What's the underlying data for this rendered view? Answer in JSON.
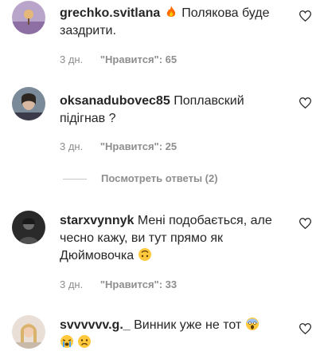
{
  "comments": [
    {
      "username": "grechko.svitlana",
      "text": " Полякова буде заздрити.",
      "emoji_after_name": "fire-emoji",
      "time": "3 дн.",
      "likes": "\"Нравится\": 65"
    },
    {
      "username": "oksanadubovec85",
      "text": " Поплавский підігнав ?",
      "time": "3 дн.",
      "likes": "\"Нравится\": 25"
    },
    {
      "username": "starxvynnyk",
      "text": " Мені подобається, але чесно кажу, ви тут прямо як Дюймовочка ",
      "emoji_end": "upside-down-face-emoji",
      "time": "3 дн.",
      "likes": "\"Нравится\": 33"
    },
    {
      "username": "svvvvvv.g._",
      "text": " Винник уже не тот",
      "emoji_end": [
        "screaming-face-emoji",
        "crying-face-emoji",
        "sad-face-emoji"
      ]
    }
  ],
  "replies_link": "Посмотреть ответы (2)",
  "colors": {
    "text": "#262626",
    "secondary": "#8e8e8e",
    "divider": "#c7c7c7",
    "emoji_yellow": "#ffc83d"
  }
}
